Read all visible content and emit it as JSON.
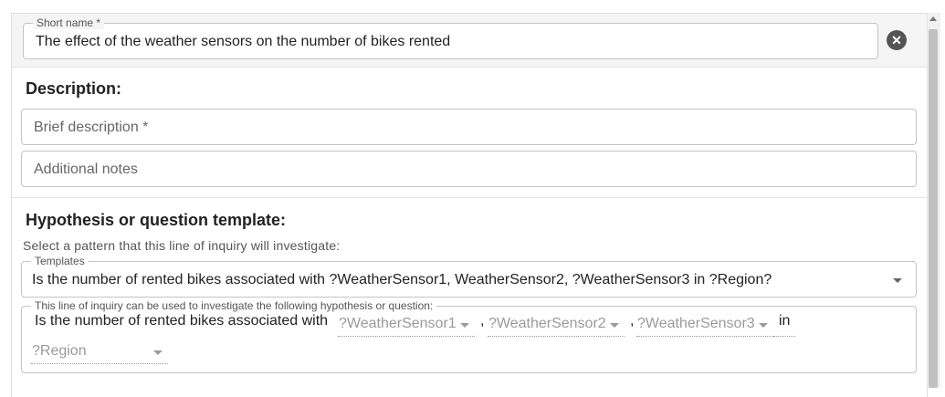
{
  "short_name": {
    "label": "Short name *",
    "value": "The effect of the weather sensors on the number of bikes rented"
  },
  "clear_icon": "close-icon",
  "description": {
    "title": "Description:",
    "brief_placeholder": "Brief description *",
    "notes_placeholder": "Additional notes"
  },
  "hypothesis": {
    "title": "Hypothesis or question template:",
    "helper": "Select a pattern that this line of inquiry will investigate:",
    "templates_label": "Templates",
    "templates_value": "Is the number of rented bikes associated with ?WeatherSensor1, WeatherSensor2, ?WeatherSensor3 in ?Region?",
    "question_label": "This line of inquiry can be used to investigate the following hypothesis or question:",
    "question_prefix": "Is the number of rented bikes associated with",
    "sep1": ",",
    "sep2": ",",
    "in_word": "in",
    "var1": "?WeatherSensor1",
    "var2": "?WeatherSensor2",
    "var3": "?WeatherSensor3",
    "var4": "?Region"
  }
}
